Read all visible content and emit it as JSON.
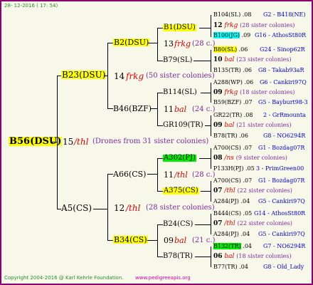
{
  "header": {
    "date": "28- 12-2016 ( 17: 54)"
  },
  "footer": {
    "copyright": "Copyright 2004-2016 @ Karl Kehrle Foundation.",
    "site": "www.pedigreeapis.org"
  },
  "root": {
    "id": "B56(DSU)",
    "mating_num": "15",
    "mating_code": "/thl",
    "drones": "(Drones from 31 sister colonies)"
  },
  "gen1": [
    {
      "id": "B23(DSU)",
      "mating_num": "14",
      "mating_code": "frkg",
      "sisters": "(50 sister colonies)"
    },
    {
      "id": "A5(CS)",
      "mating_num": "12",
      "mating_code": "/thl",
      "sisters": "(28 sister colonies)"
    }
  ],
  "gen2": [
    {
      "id": "B2(DSU)",
      "mating_num": "13",
      "mating_code": "frkg",
      "sisters": "(28 c.)"
    },
    {
      "id": "B46(BZF)",
      "mating_num": "11",
      "mating_code": "bal",
      "sisters": "(24 c.)"
    },
    {
      "id": "A66(CS)",
      "mating_num": "11",
      "mating_code": "/thl",
      "sisters": "(28 c.)"
    },
    {
      "id": "B34(CS)",
      "mating_num": "09",
      "mating_code": "bal",
      "sisters": "(21 c.)"
    }
  ],
  "gen3": [
    {
      "id": "B1(DSU)"
    },
    {
      "id": "B79(SL)"
    },
    {
      "id": "B114(SL)"
    },
    {
      "id": "GR109(TR)"
    },
    {
      "id": "A302(PJ)"
    },
    {
      "id": "A375(CS)"
    },
    {
      "id": "B24(CS)"
    },
    {
      "id": "B78(TR)"
    }
  ],
  "gen4": [
    {
      "id": "B104(SL)",
      "val": ".08",
      "link": "G2 - B418(NE)"
    },
    {
      "id": "B100(JG)",
      "val": ".09",
      "link": "G16 - AthosSt80R"
    },
    {
      "id": "B80(SL)",
      "val": ".06",
      "link": "G24 - Sinop62R"
    },
    {
      "id": "B135(TR)",
      "val": ".06",
      "link": "G8 - Takab93aR"
    },
    {
      "id": "A288(WP)",
      "val": ".06",
      "link": "G6 - Cankiri97Q"
    },
    {
      "id": "B59(BZF)",
      "val": ".07",
      "link": "G5 - Bayburt98-3"
    },
    {
      "id": "GR22(TR)",
      "val": ".08",
      "link": "2 - GrRmounta"
    },
    {
      "id": "B78(TR)",
      "val": ".06",
      "link": "G8 - NO6294R"
    },
    {
      "id": "A700(CS)",
      "val": ".07",
      "link": "G1 - Bozdag07R"
    },
    {
      "id": "P133H(PJ)",
      "val": ".05",
      "link": "3 - PrimGreen00"
    },
    {
      "id": "A700(CS)",
      "val": ".07",
      "link": "G1 - Bozdag07R"
    },
    {
      "id": "A284(PJ)",
      "val": ".04",
      "link": "G5 - Cankiri97Q"
    },
    {
      "id": "B444(CS)",
      "val": ".05",
      "link": "G14 - AthosSt80R"
    },
    {
      "id": "A284(PJ)",
      "val": ".04",
      "link": "G5 - Cankiri97Q"
    },
    {
      "id": "B132(TR)",
      "val": ".04",
      "link": "G7 - NO6294R"
    },
    {
      "id": "B77(TR)",
      "val": ".04",
      "link": "G8 - Old_Lady"
    }
  ],
  "gen4_matings": [
    {
      "num": "12",
      "code": "frkg",
      "sisters": "(28 sister colonies)"
    },
    {
      "num": "10",
      "code": "bal",
      "sisters": "(23 sister colonies)"
    },
    {
      "num": "09",
      "code": "frkg",
      "sisters": "(18 sister colonies)"
    },
    {
      "num": "09",
      "code": "bal",
      "sisters": "(21 sister colonies)"
    },
    {
      "num": "08",
      "code": "/ns",
      "sisters": "(9 sister colonies)"
    },
    {
      "num": "07",
      "code": "/thl",
      "sisters": "(22 sister colonies)"
    },
    {
      "num": "07",
      "code": "/thl",
      "sisters": "(22 sister colonies)"
    },
    {
      "num": "06",
      "code": "bal",
      "sisters": "(18 sister colonies)"
    }
  ]
}
